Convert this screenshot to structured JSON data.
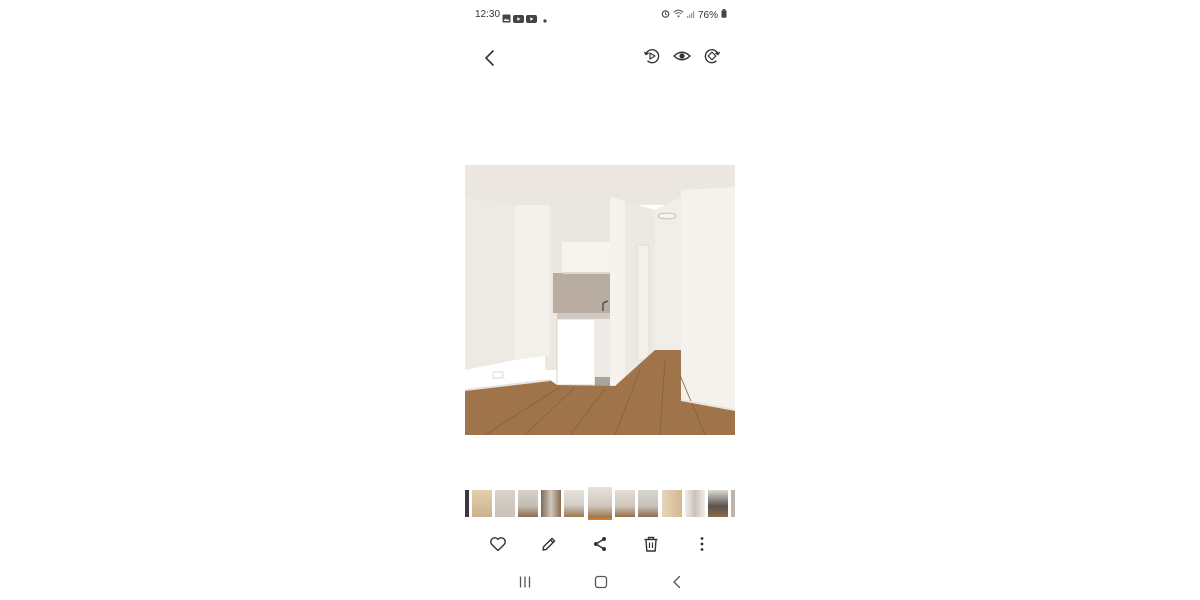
{
  "status_bar": {
    "time": "12:30",
    "battery": "76%",
    "left_icons": [
      "gallery-icon",
      "youtube-icon",
      "youtube-icon",
      "dot-icon"
    ],
    "right_icons": [
      "alarm-icon",
      "wifi-icon",
      "signal-icon",
      "battery-icon"
    ]
  },
  "top_bar": {
    "actions": [
      "remaster-icon",
      "eye-icon",
      "rotate-icon"
    ]
  },
  "photo": {
    "subject": "room-photo"
  },
  "filmstrip": {
    "thumbnail_count": 13,
    "active_index": 6
  },
  "bottom_bar": {
    "actions": [
      "heart-icon",
      "pencil-icon",
      "share-icon",
      "trash-icon",
      "more-vertical-icon"
    ]
  },
  "nav_bar": {
    "buttons": [
      "recent-apps-icon",
      "home-icon",
      "back-icon"
    ]
  },
  "colors": {
    "accent": "#d07a2d",
    "icon": "#333333",
    "background": "#ffffff"
  }
}
